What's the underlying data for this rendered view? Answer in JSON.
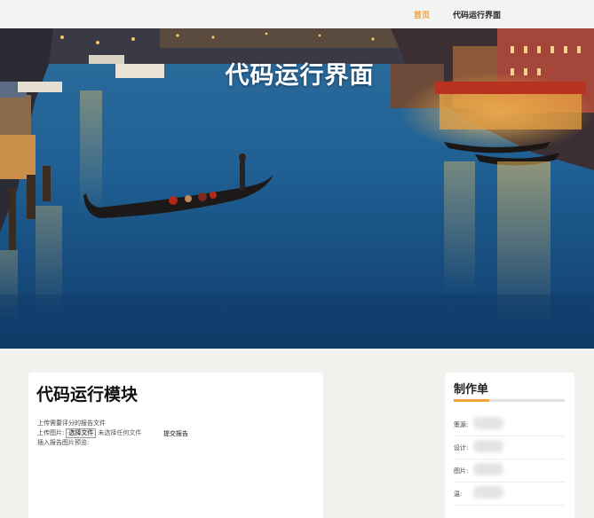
{
  "nav": {
    "home": "首页",
    "code_run": "代码运行界面"
  },
  "hero": {
    "title": "代码运行界面"
  },
  "module": {
    "title": "代码运行模块",
    "upload_report_text": "上传需要评分的报告文件",
    "upload_image_label": "上传图片:",
    "choose_file_button": "选择文件",
    "no_file_text": "未选择任何文件",
    "submit_link": "提交报告",
    "insert_preview_text": "插入报告图片预览:"
  },
  "credits": {
    "title": "制作单",
    "rows": [
      {
        "label": "策源:"
      },
      {
        "label": "设计:"
      },
      {
        "label": "图片:"
      },
      {
        "label": "温:"
      }
    ]
  },
  "colors": {
    "accent": "#f0a03c",
    "page_background": "#f2f1ee"
  }
}
